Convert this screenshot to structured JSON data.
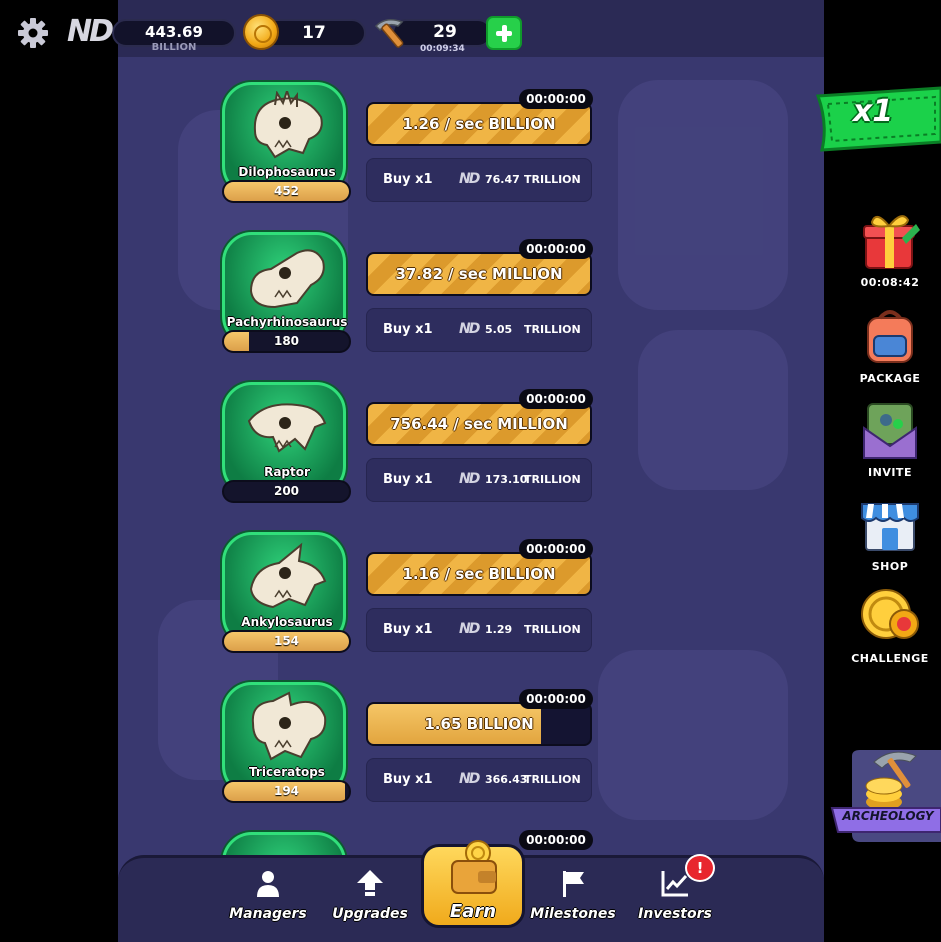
{
  "topbar": {
    "cash_value": "443.69",
    "cash_unit": "BILLION",
    "coins": "17",
    "pickaxes": "29",
    "pickaxe_timer": "00:09:34",
    "logo_text": "ND"
  },
  "dinosaurs": [
    {
      "name": "Dilophosaurus",
      "level": "452",
      "level_progress": 1.0,
      "timer": "00:00:00",
      "income": "1.26 / sec BILLION",
      "income_progress": 1.0,
      "striped": true,
      "buy_label": "Buy x1",
      "cost": "76.47",
      "cost_unit": "TRILLION"
    },
    {
      "name": "Pachyrhinosaurus",
      "level": "180",
      "level_progress": 0.2,
      "timer": "00:00:00",
      "income": "37.82 / sec MILLION",
      "income_progress": 1.0,
      "striped": true,
      "buy_label": "Buy x1",
      "cost": "5.05",
      "cost_unit": "TRILLION"
    },
    {
      "name": "Raptor",
      "level": "200",
      "level_progress": 0.0,
      "timer": "00:00:00",
      "income": "756.44 / sec MILLION",
      "income_progress": 1.0,
      "striped": true,
      "buy_label": "Buy x1",
      "cost": "173.10",
      "cost_unit": "TRILLION"
    },
    {
      "name": "Ankylosaurus",
      "level": "154",
      "level_progress": 1.0,
      "timer": "00:00:00",
      "income": "1.16 / sec BILLION",
      "income_progress": 1.0,
      "striped": true,
      "buy_label": "Buy x1",
      "cost": "1.29",
      "cost_unit": "TRILLION"
    },
    {
      "name": "Triceratops",
      "level": "194",
      "level_progress": 0.97,
      "timer": "00:00:00",
      "income": "1.65 BILLION",
      "income_progress": 0.78,
      "striped": false,
      "buy_label": "Buy x1",
      "cost": "366.43",
      "cost_unit": "TRILLION"
    }
  ],
  "partial_row": {
    "timer": "00:00:00"
  },
  "bottom_nav": {
    "managers": "Managers",
    "upgrades": "Upgrades",
    "earn": "Earn",
    "milestones": "Milestones",
    "investors": "Investors",
    "investors_badge": "!"
  },
  "right_rail": {
    "multiplier": "x1",
    "gift_timer": "00:08:42",
    "package": "PACKAGE",
    "invite": "INVITE",
    "shop": "SHOP",
    "challenge": "CHALLENGE",
    "archeology": "ARCHEOLOGY"
  },
  "colors": {
    "panel": "#39386f",
    "accent_gold": "#f0b545",
    "card_green": "#1fb25f",
    "alert_red": "#e8262e",
    "plus_green": "#27d04a"
  }
}
